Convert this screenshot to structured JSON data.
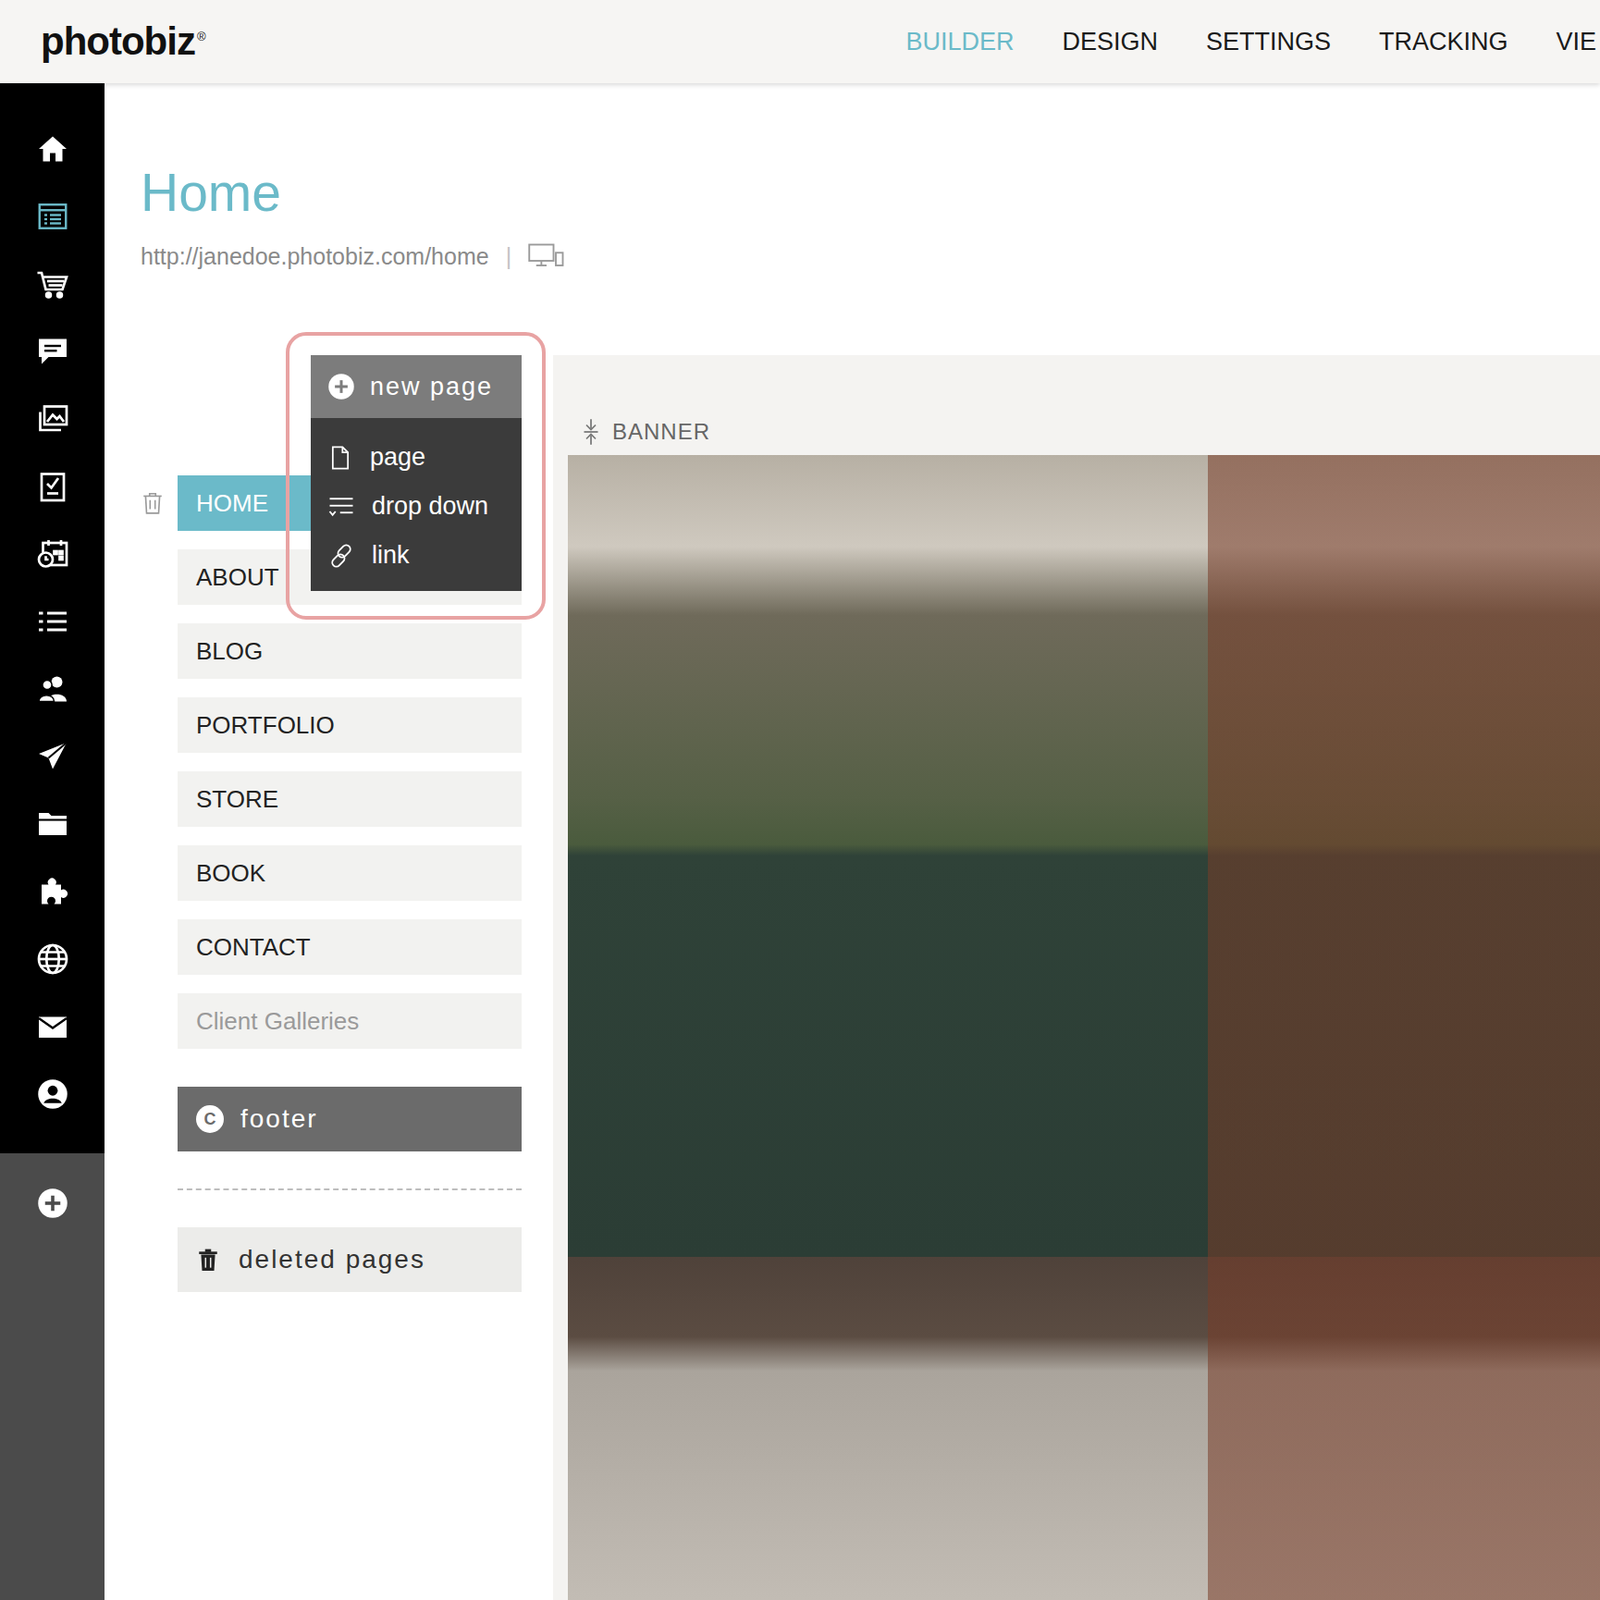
{
  "logo": {
    "text": "photobiz",
    "mark": "®"
  },
  "nav": [
    {
      "label": "BUILDER",
      "selected": true
    },
    {
      "label": "DESIGN",
      "selected": false
    },
    {
      "label": "SETTINGS",
      "selected": false
    },
    {
      "label": "TRACKING",
      "selected": false
    },
    {
      "label": "VIE",
      "selected": false
    }
  ],
  "sidebar": {
    "items": [
      {
        "selected": false
      },
      {
        "selected": true
      },
      {
        "selected": false
      },
      {
        "selected": false
      },
      {
        "selected": false
      },
      {
        "selected": false
      },
      {
        "selected": false
      },
      {
        "selected": false
      },
      {
        "selected": false
      },
      {
        "selected": false
      },
      {
        "selected": false
      },
      {
        "selected": false
      },
      {
        "selected": false
      },
      {
        "selected": false
      },
      {
        "selected": false
      }
    ]
  },
  "page": {
    "title": "Home",
    "url": "http://janedoe.photobiz.com/home",
    "separator": "|"
  },
  "pages": [
    {
      "label": "HOME",
      "selected": true,
      "hidden": false
    },
    {
      "label": "ABOUT",
      "selected": false,
      "hidden": false
    },
    {
      "label": "BLOG",
      "selected": false,
      "hidden": false
    },
    {
      "label": "PORTFOLIO",
      "selected": false,
      "hidden": false
    },
    {
      "label": "STORE",
      "selected": false,
      "hidden": false
    },
    {
      "label": "BOOK",
      "selected": false,
      "hidden": false
    },
    {
      "label": "CONTACT",
      "selected": false,
      "hidden": false
    },
    {
      "label": "Client Galleries",
      "selected": false,
      "hidden": true
    }
  ],
  "footer": {
    "label": "footer",
    "mark": "C"
  },
  "deleted": {
    "label": "deleted pages"
  },
  "menu": {
    "title": "new page",
    "items": [
      {
        "label": "page"
      },
      {
        "label": "drop down"
      },
      {
        "label": "link"
      }
    ]
  },
  "preview": {
    "section": "BANNER"
  }
}
